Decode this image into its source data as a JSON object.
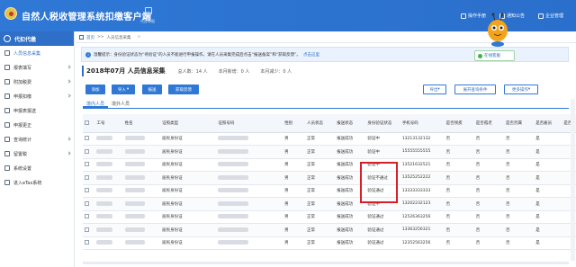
{
  "app": {
    "title": "自然人税收管理系统扣缴客户端",
    "mini_label": "代办申报"
  },
  "top_menu": [
    {
      "label": "操作手册"
    },
    {
      "label": "通知公告"
    },
    {
      "label": "企业管理"
    }
  ],
  "sidebar": {
    "head": "代扣代缴",
    "items": [
      {
        "label": "人员信息采集",
        "icon": "person-icon",
        "active": true
      },
      {
        "label": "报表填写",
        "icon": "form-icon",
        "chevron": true
      },
      {
        "label": "附加税费",
        "icon": "grid-icon",
        "chevron": true
      },
      {
        "label": "申报扣缴",
        "icon": "check-icon",
        "chevron": true
      },
      {
        "label": "申报表报送",
        "icon": "send-icon"
      },
      {
        "label": "申报更正",
        "icon": "edit-icon"
      },
      {
        "label": "查询统计",
        "icon": "search-icon",
        "chevron": true
      },
      {
        "label": "留置税",
        "icon": "doc-icon",
        "chevron": true
      },
      {
        "label": "系统设置",
        "icon": "gear-icon"
      },
      {
        "label": "进入eTax系统",
        "icon": "link-icon"
      }
    ]
  },
  "breadcrumb": {
    "home": "首页",
    "sep": ">>",
    "current": "人员信息采集"
  },
  "notice": {
    "text": "温馨提示：身份验证状态为“待验证”的人员不能进行申报操作，请在人员采集完成后点击“报送备案”和“获取反馈”。",
    "link": "点击这里"
  },
  "online_service": "在线客服",
  "summary": {
    "title": "2018年07月  人员信息采集",
    "stats": [
      "总人数：14 人",
      "本月新增：0 人",
      "本月减少：0 人"
    ]
  },
  "toolbar": {
    "buttons": [
      "添加",
      "导入",
      "报送",
      "获取反馈"
    ],
    "right_buttons": [
      "导出",
      "展开查询条件",
      "更多操作"
    ]
  },
  "tabs": [
    {
      "label": "境内人员",
      "active": true
    },
    {
      "label": "境外人员",
      "active": false
    }
  ],
  "table": {
    "columns": [
      "工号",
      "姓名",
      "证照类型",
      "证照号码",
      "性别",
      "人员状态",
      "报送状态",
      "身份验证状态",
      "手机号码",
      "是否残疾",
      "是否孤老",
      "是否烈属",
      "是否雇员",
      "是否"
    ],
    "rows": [
      {
        "type": "居民身份证",
        "gender": "男",
        "status": "正常",
        "report": "报送成功",
        "verify": "验证中",
        "phone": "13213132132",
        "a": "否",
        "b": "否",
        "c": "否",
        "d": "是"
      },
      {
        "type": "居民身份证",
        "gender": "男",
        "status": "正常",
        "report": "报送成功",
        "verify": "验证中",
        "phone": "15555555555",
        "a": "否",
        "b": "否",
        "c": "否",
        "d": "是"
      },
      {
        "type": "居民身份证",
        "gender": "男",
        "status": "正常",
        "report": "报送成功",
        "verify": "验证中",
        "phone": "13521632521",
        "a": "否",
        "b": "否",
        "c": "否",
        "d": "是"
      },
      {
        "type": "居民身份证",
        "gender": "男",
        "status": "正常",
        "report": "报送成功",
        "verify": "验证不通过",
        "phone": "13525252222",
        "a": "否",
        "b": "否",
        "c": "否",
        "d": "是"
      },
      {
        "type": "居民身份证",
        "gender": "男",
        "status": "正常",
        "report": "报送成功",
        "verify": "验证通过",
        "phone": "13333333333",
        "a": "否",
        "b": "否",
        "c": "否",
        "d": "是"
      },
      {
        "type": "居民身份证",
        "gender": "男",
        "status": "正常",
        "report": "报送成功",
        "verify": "验证中",
        "phone": "13202232123",
        "a": "否",
        "b": "否",
        "c": "否",
        "d": "是"
      },
      {
        "type": "居民身份证",
        "gender": "男",
        "status": "正常",
        "report": "报送成功",
        "verify": "验证通过",
        "phone": "12526363256",
        "a": "否",
        "b": "否",
        "c": "否",
        "d": "是"
      },
      {
        "type": "居民身份证",
        "gender": "男",
        "status": "正常",
        "report": "报送成功",
        "verify": "验证通过",
        "phone": "13363256321",
        "a": "否",
        "b": "否",
        "c": "否",
        "d": "是"
      },
      {
        "type": "居民身份证",
        "gender": "男",
        "status": "正常",
        "report": "报送成功",
        "verify": "验证通过",
        "phone": "12352563256",
        "a": "否",
        "b": "否",
        "c": "否",
        "d": "是"
      }
    ]
  },
  "colors": {
    "primary": "#2f78d6",
    "highlight_box": "#d61f26"
  }
}
